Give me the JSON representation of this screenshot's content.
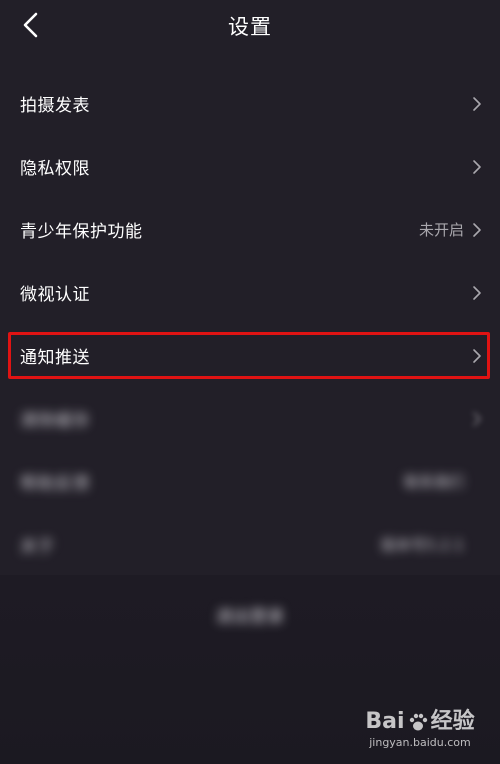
{
  "header": {
    "title": "设置",
    "back_icon": "chevron-left-icon"
  },
  "settings": {
    "items": [
      {
        "label": "拍摄发表",
        "value": ""
      },
      {
        "label": "隐私权限",
        "value": ""
      },
      {
        "label": "青少年保护功能",
        "value": "未开启"
      },
      {
        "label": "微视认证",
        "value": ""
      },
      {
        "label": "通知推送",
        "value": ""
      }
    ],
    "blurred_items": [
      {
        "label": "清除缓存",
        "value": ""
      },
      {
        "label": "帮助反馈",
        "value": "联系我们"
      },
      {
        "label": "关于",
        "value": "版本号5.2.1"
      }
    ]
  },
  "logout": {
    "label": "退出登录"
  },
  "watermark": {
    "logo_prefix": "Bai",
    "logo_suffix": "经验",
    "url": "jingyan.baidu.com"
  },
  "colors": {
    "background": "#221f28",
    "highlight": "#e01313",
    "secondary_text": "#a9a7ad"
  }
}
